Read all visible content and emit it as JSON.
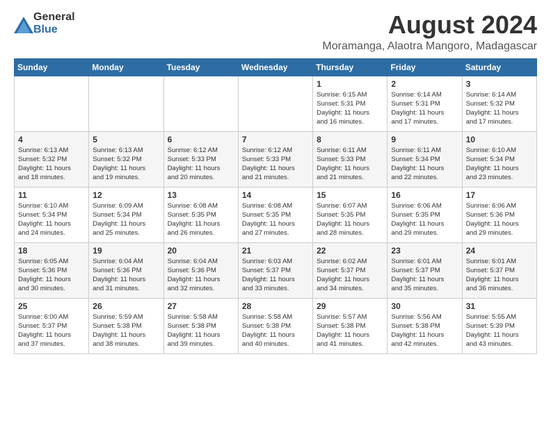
{
  "header": {
    "logo": {
      "general": "General",
      "blue": "Blue"
    },
    "month": "August 2024",
    "location": "Moramanga, Alaotra Mangoro, Madagascar"
  },
  "weekdays": [
    "Sunday",
    "Monday",
    "Tuesday",
    "Wednesday",
    "Thursday",
    "Friday",
    "Saturday"
  ],
  "weeks": [
    [
      {
        "day": "",
        "content": ""
      },
      {
        "day": "",
        "content": ""
      },
      {
        "day": "",
        "content": ""
      },
      {
        "day": "",
        "content": ""
      },
      {
        "day": "1",
        "content": "Sunrise: 6:15 AM\nSunset: 5:31 PM\nDaylight: 11 hours\nand 16 minutes."
      },
      {
        "day": "2",
        "content": "Sunrise: 6:14 AM\nSunset: 5:31 PM\nDaylight: 11 hours\nand 17 minutes."
      },
      {
        "day": "3",
        "content": "Sunrise: 6:14 AM\nSunset: 5:32 PM\nDaylight: 11 hours\nand 17 minutes."
      }
    ],
    [
      {
        "day": "4",
        "content": "Sunrise: 6:13 AM\nSunset: 5:32 PM\nDaylight: 11 hours\nand 18 minutes."
      },
      {
        "day": "5",
        "content": "Sunrise: 6:13 AM\nSunset: 5:32 PM\nDaylight: 11 hours\nand 19 minutes."
      },
      {
        "day": "6",
        "content": "Sunrise: 6:12 AM\nSunset: 5:33 PM\nDaylight: 11 hours\nand 20 minutes."
      },
      {
        "day": "7",
        "content": "Sunrise: 6:12 AM\nSunset: 5:33 PM\nDaylight: 11 hours\nand 21 minutes."
      },
      {
        "day": "8",
        "content": "Sunrise: 6:11 AM\nSunset: 5:33 PM\nDaylight: 11 hours\nand 21 minutes."
      },
      {
        "day": "9",
        "content": "Sunrise: 6:11 AM\nSunset: 5:34 PM\nDaylight: 11 hours\nand 22 minutes."
      },
      {
        "day": "10",
        "content": "Sunrise: 6:10 AM\nSunset: 5:34 PM\nDaylight: 11 hours\nand 23 minutes."
      }
    ],
    [
      {
        "day": "11",
        "content": "Sunrise: 6:10 AM\nSunset: 5:34 PM\nDaylight: 11 hours\nand 24 minutes."
      },
      {
        "day": "12",
        "content": "Sunrise: 6:09 AM\nSunset: 5:34 PM\nDaylight: 11 hours\nand 25 minutes."
      },
      {
        "day": "13",
        "content": "Sunrise: 6:08 AM\nSunset: 5:35 PM\nDaylight: 11 hours\nand 26 minutes."
      },
      {
        "day": "14",
        "content": "Sunrise: 6:08 AM\nSunset: 5:35 PM\nDaylight: 11 hours\nand 27 minutes."
      },
      {
        "day": "15",
        "content": "Sunrise: 6:07 AM\nSunset: 5:35 PM\nDaylight: 11 hours\nand 28 minutes."
      },
      {
        "day": "16",
        "content": "Sunrise: 6:06 AM\nSunset: 5:35 PM\nDaylight: 11 hours\nand 29 minutes."
      },
      {
        "day": "17",
        "content": "Sunrise: 6:06 AM\nSunset: 5:36 PM\nDaylight: 11 hours\nand 29 minutes."
      }
    ],
    [
      {
        "day": "18",
        "content": "Sunrise: 6:05 AM\nSunset: 5:36 PM\nDaylight: 11 hours\nand 30 minutes."
      },
      {
        "day": "19",
        "content": "Sunrise: 6:04 AM\nSunset: 5:36 PM\nDaylight: 11 hours\nand 31 minutes."
      },
      {
        "day": "20",
        "content": "Sunrise: 6:04 AM\nSunset: 5:36 PM\nDaylight: 11 hours\nand 32 minutes."
      },
      {
        "day": "21",
        "content": "Sunrise: 6:03 AM\nSunset: 5:37 PM\nDaylight: 11 hours\nand 33 minutes."
      },
      {
        "day": "22",
        "content": "Sunrise: 6:02 AM\nSunset: 5:37 PM\nDaylight: 11 hours\nand 34 minutes."
      },
      {
        "day": "23",
        "content": "Sunrise: 6:01 AM\nSunset: 5:37 PM\nDaylight: 11 hours\nand 35 minutes."
      },
      {
        "day": "24",
        "content": "Sunrise: 6:01 AM\nSunset: 5:37 PM\nDaylight: 11 hours\nand 36 minutes."
      }
    ],
    [
      {
        "day": "25",
        "content": "Sunrise: 6:00 AM\nSunset: 5:37 PM\nDaylight: 11 hours\nand 37 minutes."
      },
      {
        "day": "26",
        "content": "Sunrise: 5:59 AM\nSunset: 5:38 PM\nDaylight: 11 hours\nand 38 minutes."
      },
      {
        "day": "27",
        "content": "Sunrise: 5:58 AM\nSunset: 5:38 PM\nDaylight: 11 hours\nand 39 minutes."
      },
      {
        "day": "28",
        "content": "Sunrise: 5:58 AM\nSunset: 5:38 PM\nDaylight: 11 hours\nand 40 minutes."
      },
      {
        "day": "29",
        "content": "Sunrise: 5:57 AM\nSunset: 5:38 PM\nDaylight: 11 hours\nand 41 minutes."
      },
      {
        "day": "30",
        "content": "Sunrise: 5:56 AM\nSunset: 5:38 PM\nDaylight: 11 hours\nand 42 minutes."
      },
      {
        "day": "31",
        "content": "Sunrise: 5:55 AM\nSunset: 5:39 PM\nDaylight: 11 hours\nand 43 minutes."
      }
    ]
  ]
}
